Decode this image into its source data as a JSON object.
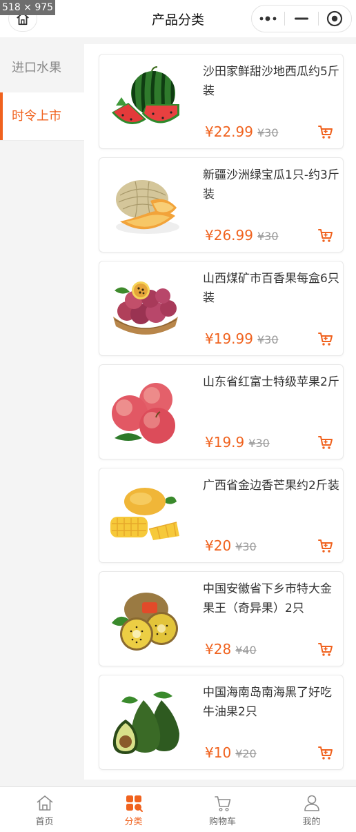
{
  "overlay": {
    "dimensions_label": "518 × 975"
  },
  "header": {
    "title": "产品分类"
  },
  "sidebar": {
    "categories": [
      {
        "label": "进口水果",
        "active": false
      },
      {
        "label": "时令上市",
        "active": true
      }
    ]
  },
  "products": [
    {
      "name": "沙田家鲜甜沙地西瓜约5斤装",
      "price": "¥22.99",
      "original_price": "¥30",
      "image": "watermelon"
    },
    {
      "name": "新疆沙洲绿宝瓜1只-约3斤装",
      "price": "¥26.99",
      "original_price": "¥30",
      "image": "melon"
    },
    {
      "name": "山西煤矿市百香果每盒6只装",
      "price": "¥19.99",
      "original_price": "¥30",
      "image": "passion-fruit"
    },
    {
      "name": "山东省红富士特级苹果2斤",
      "price": "¥19.9",
      "original_price": "¥30",
      "image": "apple"
    },
    {
      "name": "广西省金边香芒果约2斤装",
      "price": "¥20",
      "original_price": "¥30",
      "image": "mango"
    },
    {
      "name": "中国安徽省下乡市特大金果王（奇异果）2只",
      "price": "¥28",
      "original_price": "¥40",
      "image": "kiwi"
    },
    {
      "name": "中国海南岛南海黑了好吃牛油果2只",
      "price": "¥10",
      "original_price": "¥20",
      "image": "avocado"
    }
  ],
  "tabbar": {
    "items": [
      {
        "label": "首页",
        "icon": "home-icon",
        "active": false
      },
      {
        "label": "分类",
        "icon": "category-icon",
        "active": true
      },
      {
        "label": "购物车",
        "icon": "cart-icon",
        "active": false
      },
      {
        "label": "我的",
        "icon": "user-icon",
        "active": false
      }
    ]
  },
  "colors": {
    "accent": "#f0621e",
    "text": "#333333",
    "muted": "#9a9a9a"
  }
}
